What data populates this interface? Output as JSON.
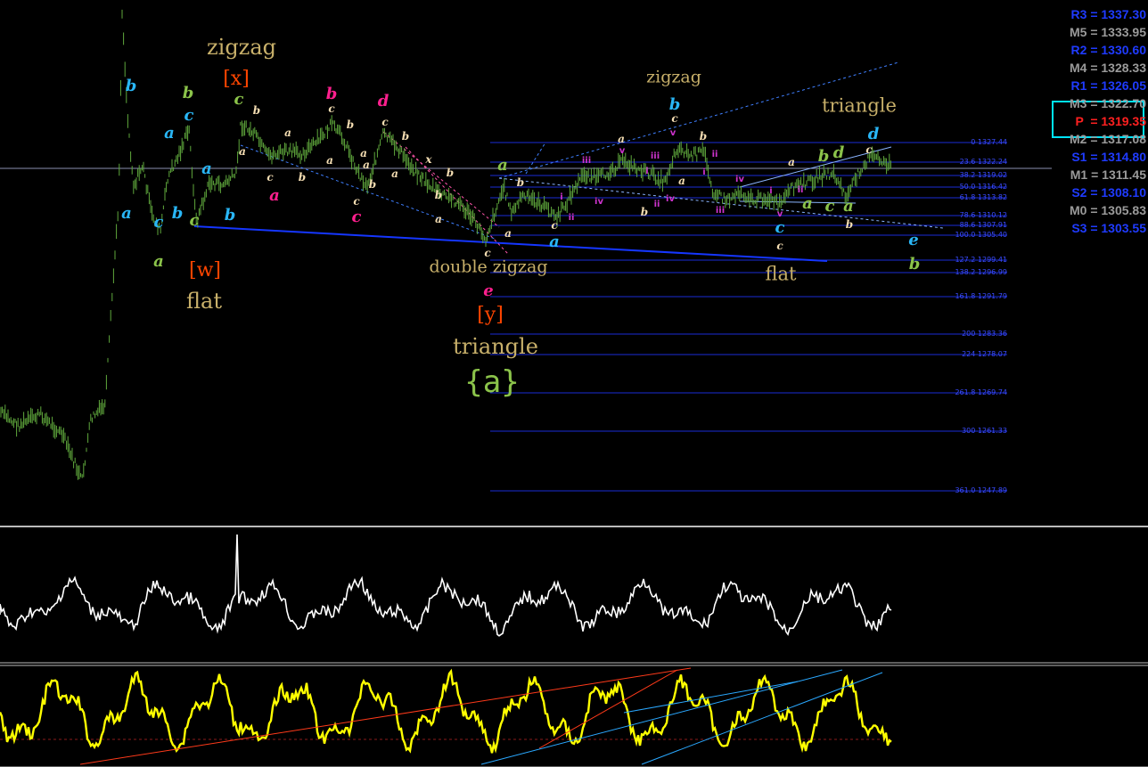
{
  "pivots": [
    {
      "text": "R3 = 1337.30",
      "color": "#1f3bff"
    },
    {
      "text": "M5 = 1333.95",
      "color": "#9a9a9a"
    },
    {
      "text": "R2 = 1330.60",
      "color": "#1f3bff"
    },
    {
      "text": "M4 = 1328.33",
      "color": "#9a9a9a"
    },
    {
      "text": "R1 = 1326.05",
      "color": "#1f3bff"
    },
    {
      "text": "M3 = 1322.70",
      "color": "#9a9a9a"
    },
    {
      "text": "P  = 1319.35",
      "color": "#ff2020"
    },
    {
      "text": "M2 = 1317.08",
      "color": "#9a9a9a"
    },
    {
      "text": "S1 = 1314.80",
      "color": "#1f3bff"
    },
    {
      "text": "M1 = 1311.45",
      "color": "#9a9a9a"
    },
    {
      "text": "S2 = 1308.10",
      "color": "#1f3bff"
    },
    {
      "text": "M0 = 1305.83",
      "color": "#9a9a9a"
    },
    {
      "text": "S3 = 1303.55",
      "color": "#1f3bff"
    }
  ],
  "fib_levels": [
    {
      "label": "0 1327.44"
    },
    {
      "label": "23.6 1322.24"
    },
    {
      "label": "38.2 1319.02"
    },
    {
      "label": "50.0 1316.42"
    },
    {
      "label": "61.8 1313.82"
    },
    {
      "label": "78.6 1310.12"
    },
    {
      "label": "88.6 1307.91"
    },
    {
      "label": "100.0 1305.40"
    },
    {
      "label": "127.2 1299.41"
    },
    {
      "label": "138.2 1296.99"
    },
    {
      "label": "161.8 1291.79"
    },
    {
      "label": "200 1283.36"
    },
    {
      "label": "224 1278.07"
    },
    {
      "label": "261.8 1269.74"
    },
    {
      "label": "300 1261.33"
    },
    {
      "label": "361.0 1247.89"
    }
  ],
  "wave_labels": [
    {
      "t": "b",
      "c": "#29b6f6"
    },
    {
      "t": "a",
      "c": "#29b6f6"
    },
    {
      "t": "a",
      "c": "#29b6f6"
    },
    {
      "t": "c",
      "c": "#29b6f6"
    },
    {
      "t": "a",
      "c": "#8bc34a"
    },
    {
      "t": "b",
      "c": "#8bc34a"
    },
    {
      "t": "c",
      "c": "#29b6f6"
    },
    {
      "t": "b",
      "c": "#29b6f6"
    },
    {
      "t": "a",
      "c": "#29b6f6"
    },
    {
      "t": "c",
      "c": "#8bc34a"
    },
    {
      "t": "b",
      "c": "#29b6f6"
    },
    {
      "t": "c",
      "c": "#8bc34a"
    },
    {
      "t": "a",
      "c": "#f5deb3"
    },
    {
      "t": "b",
      "c": "#f5deb3"
    },
    {
      "t": "a",
      "c": "#f5deb3"
    },
    {
      "t": "c",
      "c": "#f5deb3"
    },
    {
      "t": "b",
      "c": "#f5deb3"
    },
    {
      "t": "a",
      "c": "#ff1f8e"
    },
    {
      "t": "b",
      "c": "#ff1f8e"
    },
    {
      "t": "c",
      "c": "#f5deb3"
    },
    {
      "t": "a",
      "c": "#f5deb3"
    },
    {
      "t": "b",
      "c": "#f5deb3"
    },
    {
      "t": "a",
      "c": "#f5deb3"
    },
    {
      "t": "c",
      "c": "#f5deb3"
    },
    {
      "t": "b",
      "c": "#f5deb3"
    },
    {
      "t": "c",
      "c": "#ff1f8e"
    },
    {
      "t": "d",
      "c": "#ff1f8e"
    },
    {
      "t": "c",
      "c": "#f5deb3"
    },
    {
      "t": "b",
      "c": "#f5deb3"
    },
    {
      "t": "a",
      "c": "#f5deb3"
    },
    {
      "t": "a",
      "c": "#f5deb3"
    },
    {
      "t": "x",
      "c": "#f5deb3"
    },
    {
      "t": "b",
      "c": "#f5deb3"
    },
    {
      "t": "b",
      "c": "#f5deb3"
    },
    {
      "t": "a",
      "c": "#f5deb3"
    },
    {
      "t": "c",
      "c": "#f5deb3"
    },
    {
      "t": "a",
      "c": "#8bc34a"
    },
    {
      "t": "b",
      "c": "#f5deb3"
    },
    {
      "t": "a",
      "c": "#f5deb3"
    },
    {
      "t": "c",
      "c": "#f5deb3"
    },
    {
      "t": "a",
      "c": "#29b6f6"
    },
    {
      "t": "e",
      "c": "#ff1f8e"
    },
    {
      "t": "a",
      "c": "#f5deb3"
    },
    {
      "t": "b",
      "c": "#f5deb3"
    },
    {
      "t": "b",
      "c": "#29b6f6"
    },
    {
      "t": "c",
      "c": "#f5deb3"
    },
    {
      "t": "b",
      "c": "#f5deb3"
    },
    {
      "t": "a",
      "c": "#f5deb3"
    },
    {
      "t": "a",
      "c": "#f5deb3"
    },
    {
      "t": "c",
      "c": "#29b6f6"
    },
    {
      "t": "c",
      "c": "#f5deb3"
    },
    {
      "t": "b",
      "c": "#8bc34a"
    },
    {
      "t": "d",
      "c": "#8bc34a"
    },
    {
      "t": "c",
      "c": "#f5deb3"
    },
    {
      "t": "d",
      "c": "#29b6f6"
    },
    {
      "t": "a",
      "c": "#8bc34a"
    },
    {
      "t": "c",
      "c": "#8bc34a"
    },
    {
      "t": "a",
      "c": "#8bc34a"
    },
    {
      "t": "b",
      "c": "#f5deb3"
    },
    {
      "t": "e",
      "c": "#29b6f6"
    },
    {
      "t": "b",
      "c": "#8bc34a"
    },
    {
      "t": "iii",
      "c": "#cc33cc"
    },
    {
      "t": "iv",
      "c": "#cc33cc"
    },
    {
      "t": "i",
      "c": "#cc33cc"
    },
    {
      "t": "ii",
      "c": "#cc33cc"
    },
    {
      "t": "v",
      "c": "#cc33cc"
    },
    {
      "t": "iii",
      "c": "#cc33cc"
    },
    {
      "t": "v",
      "c": "#cc33cc"
    },
    {
      "t": "i",
      "c": "#cc33cc"
    },
    {
      "t": "ii",
      "c": "#cc33cc"
    },
    {
      "t": "iv",
      "c": "#cc33cc"
    },
    {
      "t": "ii",
      "c": "#cc33cc"
    },
    {
      "t": "i",
      "c": "#cc33cc"
    },
    {
      "t": "iv",
      "c": "#cc33cc"
    },
    {
      "t": "iii",
      "c": "#cc33cc"
    },
    {
      "t": "v",
      "c": "#cc33cc"
    },
    {
      "t": "i",
      "c": "#cc33cc"
    },
    {
      "t": "ii",
      "c": "#cc33cc"
    }
  ],
  "pattern_labels": [
    {
      "t": "zigzag"
    },
    {
      "t": "flat"
    },
    {
      "t": "double zigzag"
    },
    {
      "t": "triangle"
    },
    {
      "t": "zigzag"
    },
    {
      "t": "triangle"
    },
    {
      "t": "flat"
    }
  ],
  "bracket_labels": [
    {
      "t": "[x]"
    },
    {
      "t": "[w]"
    },
    {
      "t": "[y]"
    }
  ],
  "degree_label": {
    "t": "{a}"
  },
  "chart_data": {
    "type": "line",
    "panels": [
      "price",
      "oscillator-white",
      "oscillator-yellow"
    ],
    "price_series_color": "#5fa83c",
    "osc1_color": "#ffffff",
    "osc2_color": "#ffff00",
    "fib_line_color": "#1a2bd6",
    "pivot_box_color": "#00e5ff"
  }
}
